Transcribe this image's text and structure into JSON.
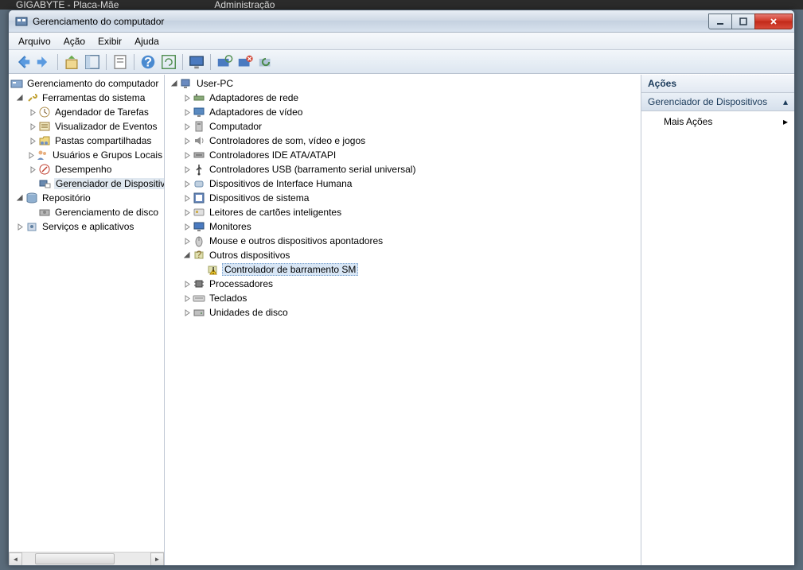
{
  "browser_tabs": [
    "GIGABYTE - Placa-Mãe",
    "Administração"
  ],
  "window": {
    "title": "Gerenciamento do computador"
  },
  "menubar": [
    "Arquivo",
    "Ação",
    "Exibir",
    "Ajuda"
  ],
  "left_tree": {
    "root": "Gerenciamento do computador",
    "tools": {
      "label": "Ferramentas do sistema",
      "items": [
        "Agendador de Tarefas",
        "Visualizador de Eventos",
        "Pastas compartilhadas",
        "Usuários e Grupos Locais",
        "Desempenho",
        "Gerenciador de Dispositivos"
      ]
    },
    "storage": {
      "label": "Repositório",
      "items": [
        "Gerenciamento de disco"
      ]
    },
    "services": "Serviços e aplicativos"
  },
  "device_tree": {
    "root": "User-PC",
    "categories": [
      {
        "label": "Adaptadores de rede",
        "expanded": false
      },
      {
        "label": "Adaptadores de vídeo",
        "expanded": false
      },
      {
        "label": "Computador",
        "expanded": false
      },
      {
        "label": "Controladores de som, vídeo e jogos",
        "expanded": false
      },
      {
        "label": "Controladores IDE ATA/ATAPI",
        "expanded": false
      },
      {
        "label": "Controladores USB (barramento serial universal)",
        "expanded": false
      },
      {
        "label": "Dispositivos de Interface Humana",
        "expanded": false
      },
      {
        "label": "Dispositivos de sistema",
        "expanded": false
      },
      {
        "label": "Leitores de cartões inteligentes",
        "expanded": false
      },
      {
        "label": "Monitores",
        "expanded": false
      },
      {
        "label": "Mouse e outros dispositivos apontadores",
        "expanded": false
      },
      {
        "label": "Outros dispositivos",
        "expanded": true,
        "children": [
          {
            "label": "Controlador de barramento SM",
            "selected": true,
            "warning": true
          }
        ]
      },
      {
        "label": "Processadores",
        "expanded": false
      },
      {
        "label": "Teclados",
        "expanded": false
      },
      {
        "label": "Unidades de disco",
        "expanded": false
      }
    ]
  },
  "actions": {
    "header": "Ações",
    "section": "Gerenciador de Dispositivos",
    "more": "Mais Ações"
  }
}
